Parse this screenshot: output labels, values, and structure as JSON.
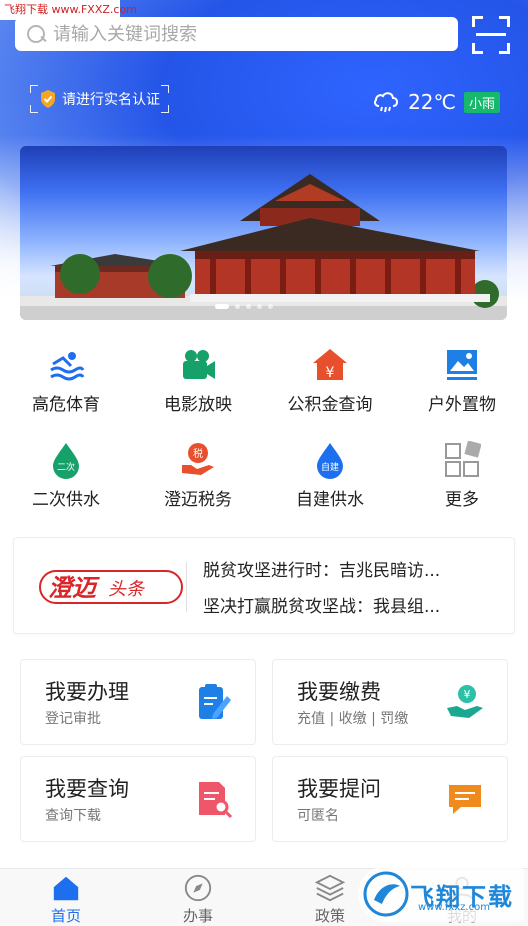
{
  "watermark": "飞翔下载 www.FXXZ.com",
  "search": {
    "placeholder": "请输入关键词搜索"
  },
  "verify": {
    "label": "请进行实名认证"
  },
  "weather": {
    "temperature": "22℃",
    "condition": "小雨"
  },
  "services": [
    {
      "label": "高危体育",
      "icon": "swimming-icon"
    },
    {
      "label": "电影放映",
      "icon": "movie-camera-icon"
    },
    {
      "label": "公积金查询",
      "icon": "house-yen-icon"
    },
    {
      "label": "户外置物",
      "icon": "picture-icon"
    },
    {
      "label": "二次供水",
      "icon": "water-drop-icon"
    },
    {
      "label": "澄迈税务",
      "icon": "tax-hand-icon"
    },
    {
      "label": "自建供水",
      "icon": "water-drop-icon"
    },
    {
      "label": "更多",
      "icon": "more-grid-icon"
    }
  ],
  "news": {
    "logo_text": "澄迈",
    "logo_sub": "头条",
    "items": [
      "脱贫攻坚进行时：吉兆民暗访...",
      "坚决打赢脱贫攻坚战：我县组..."
    ]
  },
  "cards": [
    {
      "title": "我要办理",
      "sub": "登记审批",
      "icon": "clipboard-pen-icon"
    },
    {
      "title": "我要缴费",
      "sub": "充值 | 收缴 | 罚缴",
      "icon": "hand-coin-icon"
    },
    {
      "title": "我要查询",
      "sub": "查询下载",
      "icon": "document-search-icon"
    },
    {
      "title": "我要提问",
      "sub": "可匿名",
      "icon": "chat-bubble-icon"
    }
  ],
  "tabs": [
    {
      "label": "首页",
      "icon": "home-icon",
      "active": true
    },
    {
      "label": "办事",
      "icon": "compass-icon",
      "active": false
    },
    {
      "label": "政策",
      "icon": "layers-icon",
      "active": false
    },
    {
      "label": "我的",
      "icon": "user-icon",
      "active": false
    }
  ],
  "watermark_bottom": {
    "title": "飞翔下载",
    "url": "www.fxxz.com"
  },
  "colors": {
    "primary": "#1e6ff0",
    "weather_tag": "#16b96b",
    "news_red": "#d9262a",
    "drop_green": "#16a06a",
    "orange": "#f08a1c",
    "pink": "#f0566a"
  }
}
